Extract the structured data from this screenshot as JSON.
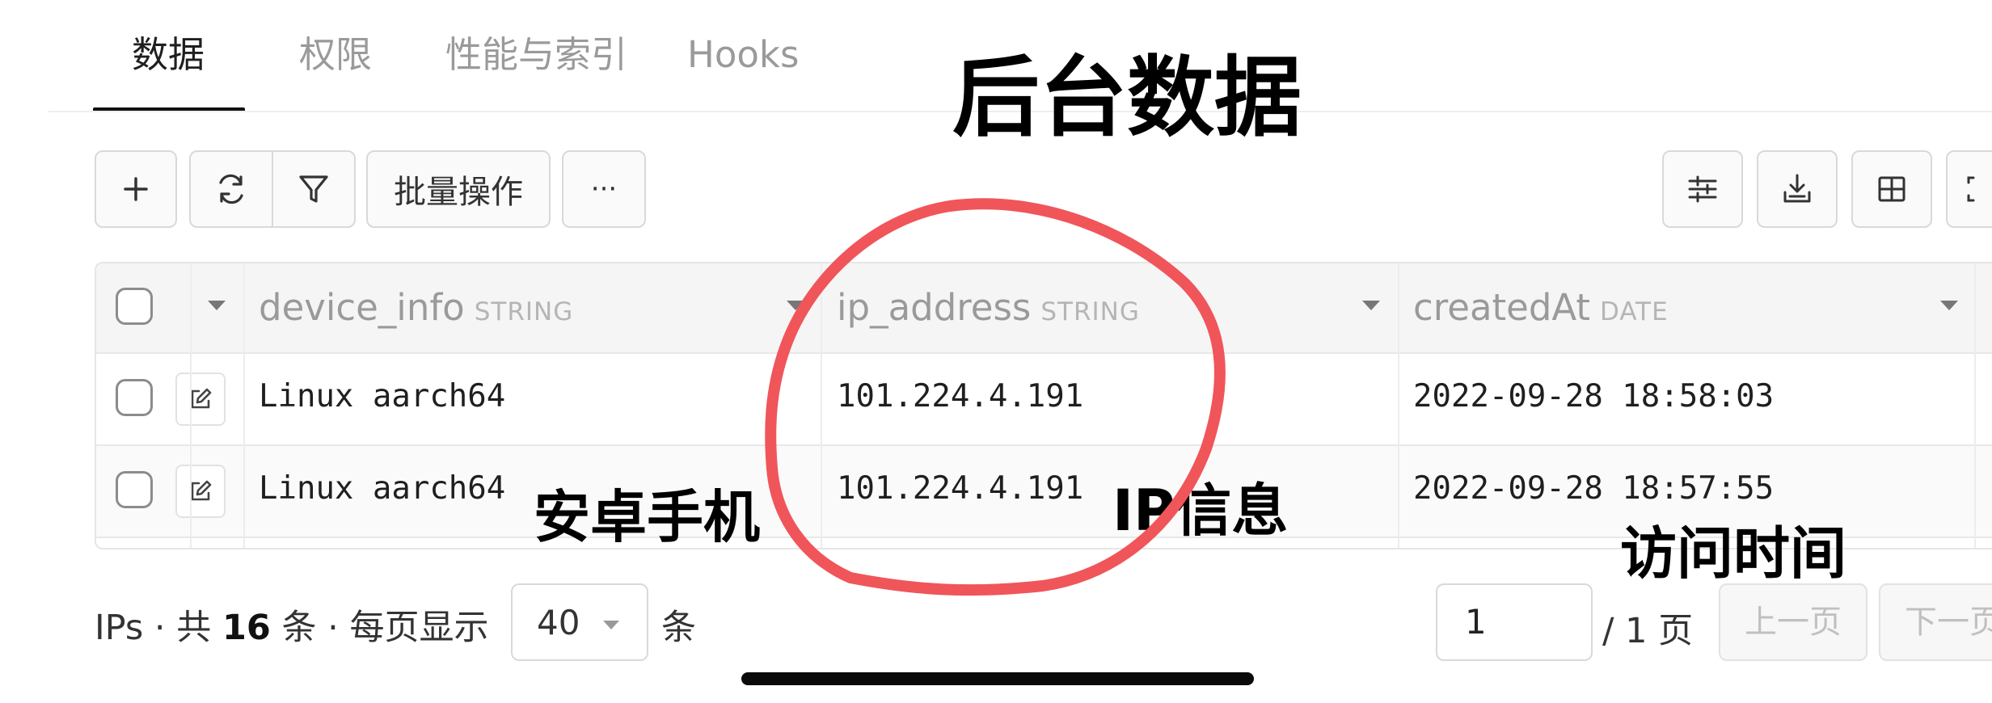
{
  "tabs": [
    "数据",
    "权限",
    "性能与索引",
    "Hooks"
  ],
  "annotations": {
    "title": "后台数据",
    "device": "安卓手机",
    "ip": "IP信息",
    "time": "访问时间",
    "circle_color": "#f0555a"
  },
  "toolbar": {
    "batch_label": "批量操作",
    "more_label": "···"
  },
  "table": {
    "columns": [
      {
        "name": "device_info",
        "type": "STRING"
      },
      {
        "name": "ip_address",
        "type": "STRING"
      },
      {
        "name": "createdAt",
        "type": "DATE"
      }
    ],
    "rows": [
      {
        "device_info": "Linux aarch64",
        "ip_address": "101.224.4.191",
        "createdAt": "2022-09-28 18:58:03"
      },
      {
        "device_info": "Linux aarch64",
        "ip_address": "101.224.4.191",
        "createdAt": "2022-09-28 18:57:55"
      }
    ]
  },
  "footer": {
    "prefix": "IPs · 共 ",
    "count": "16",
    "middle": " 条 · 每页显示",
    "page_size": "40",
    "suffix": "条",
    "current_page": "1",
    "total_pages_text": "/ 1 页",
    "prev_label": "上一页",
    "next_label": "下一页"
  },
  "colors": {
    "accent_text": "#1f1f1f",
    "muted_text": "#9a9a9a",
    "annotation_circle": "#f0555a"
  }
}
